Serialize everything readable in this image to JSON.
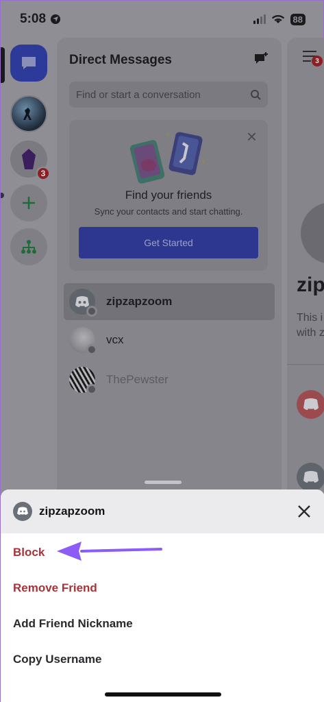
{
  "status_bar": {
    "time": "5:08",
    "battery": "88"
  },
  "rail": {
    "dm_badge_count": "3"
  },
  "direct_messages": {
    "title": "Direct Messages",
    "search_placeholder": "Find or start a conversation",
    "find_friends": {
      "title": "Find your friends",
      "subtitle": "Sync your contacts and start chatting.",
      "button": "Get Started"
    },
    "conversations": [
      {
        "name": "zipzapzoom",
        "active": true
      },
      {
        "name": "vcx",
        "active": false
      },
      {
        "name": "ThePewster",
        "active": false
      }
    ]
  },
  "right_panel": {
    "badge": "3",
    "heading_fragment": "zip",
    "line1": "This i",
    "line2": "with z"
  },
  "sheet": {
    "username": "zipzapzoom",
    "options": {
      "block": "Block",
      "remove_friend": "Remove Friend",
      "add_nickname": "Add Friend Nickname",
      "copy_username": "Copy Username"
    }
  },
  "colors": {
    "danger": "#a8323a",
    "blurple": "#5865f2",
    "annotation_arrow": "#8b5cf6"
  }
}
